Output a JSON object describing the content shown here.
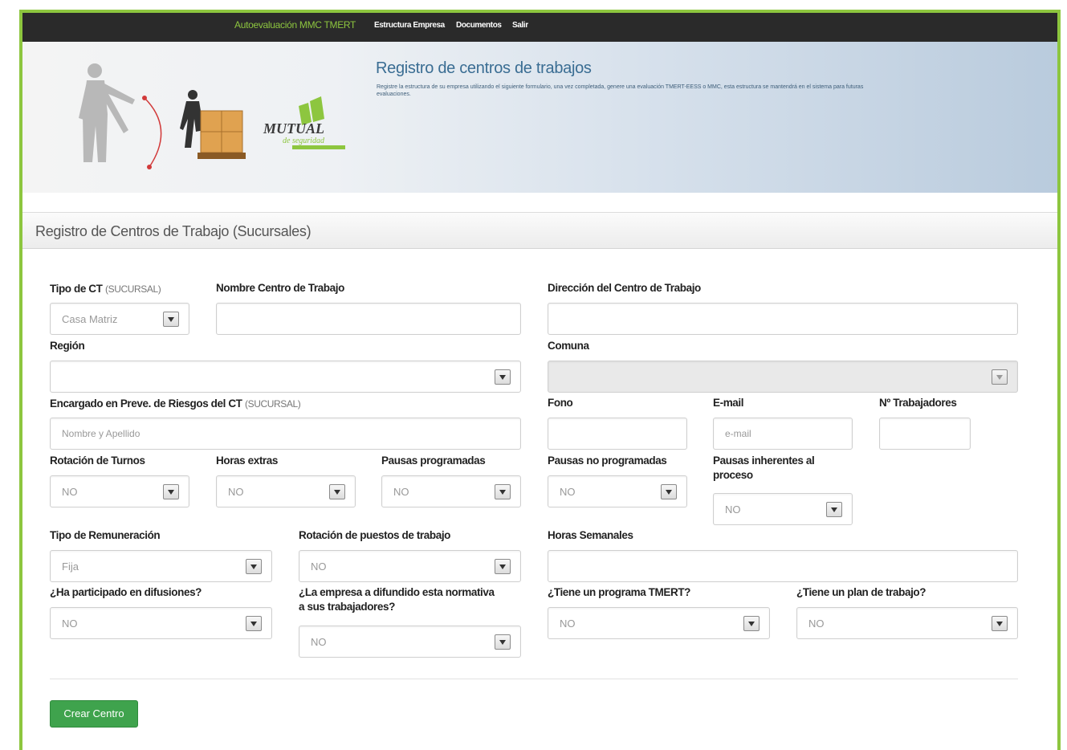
{
  "nav": {
    "brand": "Autoevaluación MMC TMERT",
    "links": [
      "Estructura Empresa",
      "Documentos",
      "Salir"
    ]
  },
  "hero": {
    "title": "Registro de centros de trabajos",
    "description": "Registre la estructura de su empresa utilizando el siguiente formulario, una vez completada, genere una evaluación TMERT-EESS o MMC, esta estructura se mantendrá en el sistema para futuras evaluaciones.",
    "logo_text": "MUTUAL de seguridad"
  },
  "panel": {
    "title": "Registro de Centros de Trabajo (Sucursales)"
  },
  "form": {
    "tipo_ct": {
      "label": "Tipo de CT",
      "sub": "(SUCURSAL)",
      "value": "Casa Matriz"
    },
    "nombre": {
      "label": "Nombre Centro de Trabajo",
      "value": ""
    },
    "direccion": {
      "label": "Dirección del Centro de Trabajo",
      "value": ""
    },
    "region": {
      "label": "Región",
      "value": ""
    },
    "comuna": {
      "label": "Comuna",
      "value": ""
    },
    "encargado": {
      "label": "Encargado en Preve. de Riesgos del CT",
      "sub": "(SUCURSAL)",
      "placeholder": "Nombre y Apellido"
    },
    "fono": {
      "label": "Fono",
      "value": ""
    },
    "email": {
      "label": "E-mail",
      "placeholder": "e-mail"
    },
    "trabajadores": {
      "label": "Nº Trabajadores",
      "value": ""
    },
    "rotacion_turnos": {
      "label": "Rotación de Turnos",
      "value": "NO"
    },
    "horas_extras": {
      "label": "Horas extras",
      "value": "NO"
    },
    "pausas_programadas": {
      "label": "Pausas programadas",
      "value": "NO"
    },
    "pausas_no_programadas": {
      "label": "Pausas no programadas",
      "value": "NO"
    },
    "pausas_inherentes": {
      "label_1": "Pausas inherentes al",
      "label_2": "proceso",
      "value": "NO"
    },
    "tipo_remuneracion": {
      "label": "Tipo de Remuneración",
      "value": "Fija"
    },
    "rotacion_puestos": {
      "label": "Rotación de puestos de trabajo",
      "value": "NO"
    },
    "horas_semanales": {
      "label": "Horas Semanales",
      "value": ""
    },
    "difusiones": {
      "label": "¿Ha participado en difusiones?",
      "value": "NO"
    },
    "normativa": {
      "label_1": "¿La empresa a difundido esta normativa",
      "label_2": "a sus trabajadores?",
      "value": "NO"
    },
    "programa_tmert": {
      "label": "¿Tiene un programa TMERT?",
      "value": "NO"
    },
    "plan_trabajo": {
      "label": "¿Tiene un plan de trabajo?",
      "value": "NO"
    }
  },
  "submit_label": "Crear Centro"
}
